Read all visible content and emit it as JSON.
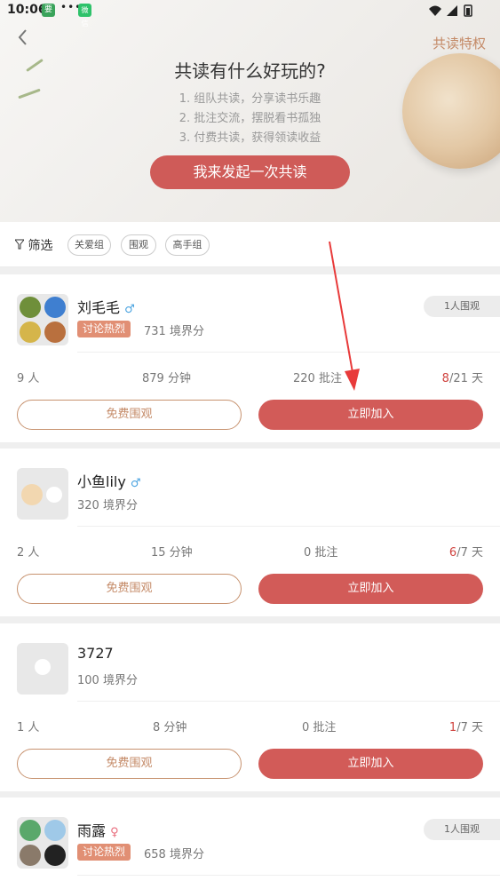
{
  "status": {
    "time": "10:06",
    "app1": "要",
    "dots": "•••",
    "app2": "微信"
  },
  "header": {
    "privilege": "共读特权",
    "title": "共读有什么好玩的?",
    "lines": [
      "1. 组队共读，分享读书乐趣",
      "2. 批注交流，摆脱看书孤独",
      "3. 付费共读，获得领读收益"
    ],
    "cta": "我来发起一次共读"
  },
  "filter": {
    "label": "筛选",
    "chips": [
      "关爱组",
      "围观",
      "高手组"
    ]
  },
  "cards": [
    {
      "name": "刘毛毛",
      "gender": "♂",
      "tag": "讨论热烈",
      "score": "731 境界分",
      "watchers": "1人围观",
      "people": "9 人",
      "minutes": "879 分钟",
      "notes": "220 批注",
      "days_done": "8",
      "days_total": "/21 天",
      "spectate": "免费围观",
      "join": "立即加入"
    },
    {
      "name": "小鱼lily",
      "gender": "♂",
      "tag": "",
      "score": "320 境界分",
      "watchers": "",
      "people": "2 人",
      "minutes": "15 分钟",
      "notes": "0 批注",
      "days_done": "6",
      "days_total": "/7 天",
      "spectate": "免费围观",
      "join": "立即加入"
    },
    {
      "name": "3727",
      "gender": "",
      "tag": "",
      "score": "100 境界分",
      "watchers": "",
      "people": "1 人",
      "minutes": "8 分钟",
      "notes": "0 批注",
      "days_done": "1",
      "days_total": "/7 天",
      "spectate": "免费围观",
      "join": "立即加入"
    },
    {
      "name": "雨露",
      "gender": "♀",
      "tag": "讨论热烈",
      "score": "658 境界分",
      "watchers": "1人围观",
      "people": "",
      "minutes": "",
      "notes": "",
      "days_done": "",
      "days_total": "",
      "spectate": "",
      "join": ""
    }
  ],
  "colors": {
    "accent": "#d25b58",
    "outline": "#c48a67",
    "tag": "#e18f74",
    "male": "#4aa3e0",
    "female": "#e86a7a"
  }
}
